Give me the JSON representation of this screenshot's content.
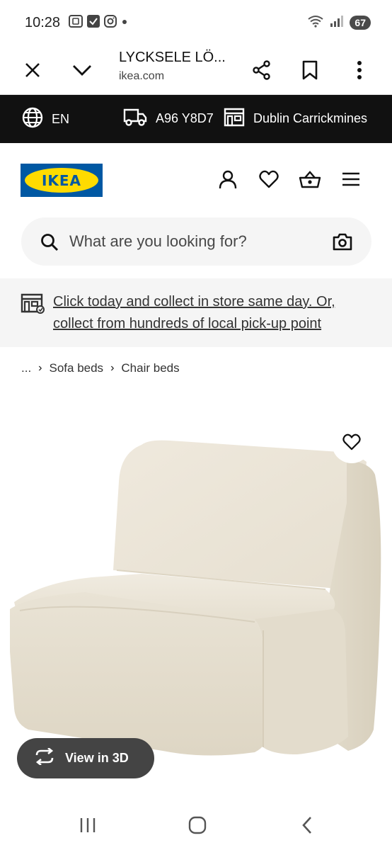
{
  "status": {
    "time": "10:28",
    "battery": "67",
    "icons": [
      "screenshot-icon",
      "check-icon",
      "instagram-icon",
      "dot-icon",
      "wifi-icon",
      "signal-icon"
    ]
  },
  "browser": {
    "title": "LYCKSELE LÖ...",
    "url": "ikea.com",
    "icons": [
      "close-icon",
      "chevron-down-icon",
      "share-icon",
      "bookmark-icon",
      "more-vert-icon"
    ]
  },
  "store_bar": {
    "language": "EN",
    "postcode": "A96 Y8D7",
    "store": "Dublin Carrickmines",
    "icons": [
      "globe-icon",
      "truck-icon",
      "store-icon"
    ]
  },
  "header": {
    "logo_text": "IKEA",
    "icons": [
      "account-icon",
      "heart-icon",
      "basket-icon",
      "menu-icon"
    ]
  },
  "search": {
    "placeholder": "What are you looking for?",
    "icons": [
      "search-icon",
      "camera-icon"
    ]
  },
  "promo": {
    "text": "Click today and collect in store same day. Or, collect from hundreds of local pick-up point"
  },
  "breadcrumb": {
    "items": [
      "...",
      "Sofa beds",
      "Chair beds"
    ]
  },
  "product": {
    "view_3d_label": "View in 3D"
  },
  "colors": {
    "ikea_blue": "#0058a3",
    "ikea_yellow": "#ffdb00",
    "store_bar_bg": "#111111",
    "search_bg": "#f5f5f5",
    "view3d_bg": "#444444"
  }
}
